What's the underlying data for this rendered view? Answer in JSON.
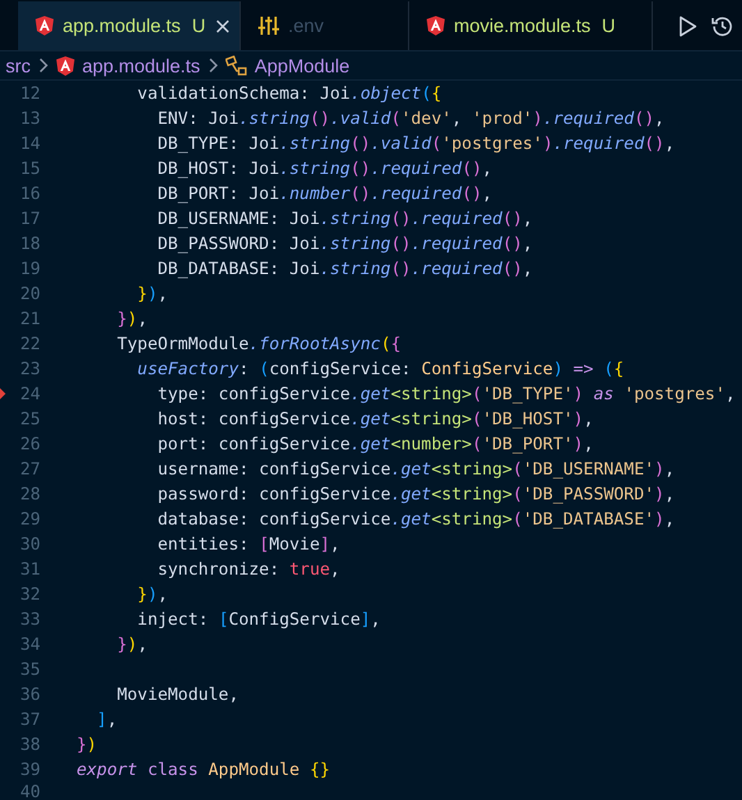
{
  "tabs": [
    {
      "label": "app.module.ts",
      "badge": "U",
      "kind": "file",
      "selected": true,
      "dimmed": false,
      "closable": true
    },
    {
      "label": ".env",
      "kind": "config",
      "selected": false,
      "dimmed": true,
      "closable": false
    },
    {
      "label": "movie.module.ts",
      "badge": "U",
      "kind": "file",
      "selected": false,
      "dimmed": false,
      "closable": false
    }
  ],
  "breadcrumb": [
    {
      "label": "src",
      "kind": "folder"
    },
    {
      "label": "app.module.ts",
      "kind": "file"
    },
    {
      "label": "AppModule",
      "kind": "symbol"
    }
  ],
  "lines": [
    {
      "number": "12",
      "marker": false,
      "tokens": [
        {
          "text": "      validationSchema: Joi",
          "kind": "p"
        },
        {
          "text": ".object",
          "kind": "m"
        },
        {
          "text": "(",
          "kind": "bb"
        },
        {
          "text": "{",
          "kind": "by"
        }
      ]
    },
    {
      "number": "13",
      "marker": false,
      "tokens": [
        {
          "text": "        ENV: Joi",
          "kind": "p"
        },
        {
          "text": ".string",
          "kind": "m"
        },
        {
          "text": "()",
          "kind": "bp"
        },
        {
          "text": ".valid",
          "kind": "m"
        },
        {
          "text": "(",
          "kind": "bp"
        },
        {
          "text": "'dev'",
          "kind": "s"
        },
        {
          "text": ", ",
          "kind": "p"
        },
        {
          "text": "'prod'",
          "kind": "s"
        },
        {
          "text": ")",
          "kind": "bp"
        },
        {
          "text": ".required",
          "kind": "m"
        },
        {
          "text": "()",
          "kind": "bp"
        },
        {
          "text": ",",
          "kind": "p"
        }
      ]
    },
    {
      "number": "14",
      "marker": false,
      "tokens": [
        {
          "text": "        DB_TYPE: Joi",
          "kind": "p"
        },
        {
          "text": ".string",
          "kind": "m"
        },
        {
          "text": "()",
          "kind": "bp"
        },
        {
          "text": ".valid",
          "kind": "m"
        },
        {
          "text": "(",
          "kind": "bp"
        },
        {
          "text": "'postgres'",
          "kind": "s"
        },
        {
          "text": ")",
          "kind": "bp"
        },
        {
          "text": ".required",
          "kind": "m"
        },
        {
          "text": "()",
          "kind": "bp"
        },
        {
          "text": ",",
          "kind": "p"
        }
      ]
    },
    {
      "number": "15",
      "marker": false,
      "tokens": [
        {
          "text": "        DB_HOST: Joi",
          "kind": "p"
        },
        {
          "text": ".string",
          "kind": "m"
        },
        {
          "text": "()",
          "kind": "bp"
        },
        {
          "text": ".required",
          "kind": "m"
        },
        {
          "text": "()",
          "kind": "bp"
        },
        {
          "text": ",",
          "kind": "p"
        }
      ]
    },
    {
      "number": "16",
      "marker": false,
      "tokens": [
        {
          "text": "        DB_PORT: Joi",
          "kind": "p"
        },
        {
          "text": ".number",
          "kind": "m"
        },
        {
          "text": "()",
          "kind": "bp"
        },
        {
          "text": ".required",
          "kind": "m"
        },
        {
          "text": "()",
          "kind": "bp"
        },
        {
          "text": ",",
          "kind": "p"
        }
      ]
    },
    {
      "number": "17",
      "marker": false,
      "tokens": [
        {
          "text": "        DB_USERNAME: Joi",
          "kind": "p"
        },
        {
          "text": ".string",
          "kind": "m"
        },
        {
          "text": "()",
          "kind": "bp"
        },
        {
          "text": ".required",
          "kind": "m"
        },
        {
          "text": "()",
          "kind": "bp"
        },
        {
          "text": ",",
          "kind": "p"
        }
      ]
    },
    {
      "number": "18",
      "marker": false,
      "tokens": [
        {
          "text": "        DB_PASSWORD: Joi",
          "kind": "p"
        },
        {
          "text": ".string",
          "kind": "m"
        },
        {
          "text": "()",
          "kind": "bp"
        },
        {
          "text": ".required",
          "kind": "m"
        },
        {
          "text": "()",
          "kind": "bp"
        },
        {
          "text": ",",
          "kind": "p"
        }
      ]
    },
    {
      "number": "19",
      "marker": false,
      "tokens": [
        {
          "text": "        DB_DATABASE: Joi",
          "kind": "p"
        },
        {
          "text": ".string",
          "kind": "m"
        },
        {
          "text": "()",
          "kind": "bp"
        },
        {
          "text": ".required",
          "kind": "m"
        },
        {
          "text": "()",
          "kind": "bp"
        },
        {
          "text": ",",
          "kind": "p"
        }
      ]
    },
    {
      "number": "20",
      "marker": false,
      "tokens": [
        {
          "text": "      }",
          "kind": "by"
        },
        {
          "text": ")",
          "kind": "bb"
        },
        {
          "text": ",",
          "kind": "p"
        }
      ]
    },
    {
      "number": "21",
      "marker": false,
      "tokens": [
        {
          "text": "    }",
          "kind": "bp"
        },
        {
          "text": ")",
          "kind": "by"
        },
        {
          "text": ",",
          "kind": "p"
        }
      ]
    },
    {
      "number": "22",
      "marker": false,
      "tokens": [
        {
          "text": "    TypeOrmModule",
          "kind": "p"
        },
        {
          "text": ".forRootAsync",
          "kind": "m"
        },
        {
          "text": "(",
          "kind": "by"
        },
        {
          "text": "{",
          "kind": "bp"
        }
      ]
    },
    {
      "number": "23",
      "marker": false,
      "tokens": [
        {
          "text": "      useFactory",
          "kind": "m"
        },
        {
          "text": ": ",
          "kind": "p"
        },
        {
          "text": "(",
          "kind": "bb"
        },
        {
          "text": "configService: ",
          "kind": "p"
        },
        {
          "text": "ConfigService",
          "kind": "c"
        },
        {
          "text": ") ",
          "kind": "bb"
        },
        {
          "text": "=> ",
          "kind": "k"
        },
        {
          "text": "(",
          "kind": "bb"
        },
        {
          "text": "{",
          "kind": "by"
        }
      ]
    },
    {
      "number": "24",
      "marker": true,
      "tokens": [
        {
          "text": "        type: configService",
          "kind": "p"
        },
        {
          "text": ".get",
          "kind": "m"
        },
        {
          "text": "<string>",
          "kind": "g"
        },
        {
          "text": "(",
          "kind": "bp"
        },
        {
          "text": "'DB_TYPE'",
          "kind": "s"
        },
        {
          "text": ") ",
          "kind": "bp"
        },
        {
          "text": "as ",
          "kind": "ki"
        },
        {
          "text": "'postgres'",
          "kind": "s"
        },
        {
          "text": ",",
          "kind": "p"
        }
      ]
    },
    {
      "number": "25",
      "marker": false,
      "tokens": [
        {
          "text": "        host: configService",
          "kind": "p"
        },
        {
          "text": ".get",
          "kind": "m"
        },
        {
          "text": "<string>",
          "kind": "g"
        },
        {
          "text": "(",
          "kind": "bp"
        },
        {
          "text": "'DB_HOST'",
          "kind": "s"
        },
        {
          "text": ")",
          "kind": "bp"
        },
        {
          "text": ",",
          "kind": "p"
        }
      ]
    },
    {
      "number": "26",
      "marker": false,
      "tokens": [
        {
          "text": "        port: configService",
          "kind": "p"
        },
        {
          "text": ".get",
          "kind": "m"
        },
        {
          "text": "<number>",
          "kind": "g"
        },
        {
          "text": "(",
          "kind": "bp"
        },
        {
          "text": "'DB_PORT'",
          "kind": "s"
        },
        {
          "text": ")",
          "kind": "bp"
        },
        {
          "text": ",",
          "kind": "p"
        }
      ]
    },
    {
      "number": "27",
      "marker": false,
      "tokens": [
        {
          "text": "        username: configService",
          "kind": "p"
        },
        {
          "text": ".get",
          "kind": "m"
        },
        {
          "text": "<string>",
          "kind": "g"
        },
        {
          "text": "(",
          "kind": "bp"
        },
        {
          "text": "'DB_USERNAME'",
          "kind": "s"
        },
        {
          "text": ")",
          "kind": "bp"
        },
        {
          "text": ",",
          "kind": "p"
        }
      ]
    },
    {
      "number": "28",
      "marker": false,
      "tokens": [
        {
          "text": "        password: configService",
          "kind": "p"
        },
        {
          "text": ".get",
          "kind": "m"
        },
        {
          "text": "<string>",
          "kind": "g"
        },
        {
          "text": "(",
          "kind": "bp"
        },
        {
          "text": "'DB_PASSWORD'",
          "kind": "s"
        },
        {
          "text": ")",
          "kind": "bp"
        },
        {
          "text": ",",
          "kind": "p"
        }
      ]
    },
    {
      "number": "29",
      "marker": false,
      "tokens": [
        {
          "text": "        database: configService",
          "kind": "p"
        },
        {
          "text": ".get",
          "kind": "m"
        },
        {
          "text": "<string>",
          "kind": "g"
        },
        {
          "text": "(",
          "kind": "bp"
        },
        {
          "text": "'DB_DATABASE'",
          "kind": "s"
        },
        {
          "text": ")",
          "kind": "bp"
        },
        {
          "text": ",",
          "kind": "p"
        }
      ]
    },
    {
      "number": "30",
      "marker": false,
      "tokens": [
        {
          "text": "        entities: ",
          "kind": "p"
        },
        {
          "text": "[",
          "kind": "bp"
        },
        {
          "text": "Movie",
          "kind": "p"
        },
        {
          "text": "]",
          "kind": "bp"
        },
        {
          "text": ",",
          "kind": "p"
        }
      ]
    },
    {
      "number": "31",
      "marker": false,
      "tokens": [
        {
          "text": "        synchronize: ",
          "kind": "p"
        },
        {
          "text": "true",
          "kind": "lit"
        },
        {
          "text": ",",
          "kind": "p"
        }
      ]
    },
    {
      "number": "32",
      "marker": false,
      "tokens": [
        {
          "text": "      }",
          "kind": "by"
        },
        {
          "text": ")",
          "kind": "bb"
        },
        {
          "text": ",",
          "kind": "p"
        }
      ]
    },
    {
      "number": "33",
      "marker": false,
      "tokens": [
        {
          "text": "      inject: ",
          "kind": "p"
        },
        {
          "text": "[",
          "kind": "bb"
        },
        {
          "text": "ConfigService",
          "kind": "p"
        },
        {
          "text": "]",
          "kind": "bb"
        },
        {
          "text": ",",
          "kind": "p"
        }
      ]
    },
    {
      "number": "34",
      "marker": false,
      "tokens": [
        {
          "text": "    }",
          "kind": "bp"
        },
        {
          "text": ")",
          "kind": "by"
        },
        {
          "text": ",",
          "kind": "p"
        }
      ]
    },
    {
      "number": "35",
      "marker": false
    },
    {
      "number": "36",
      "marker": false,
      "tokens": [
        {
          "text": "    MovieModule,",
          "kind": "p"
        }
      ]
    },
    {
      "number": "37",
      "marker": false,
      "tokens": [
        {
          "text": "  ]",
          "kind": "bb"
        },
        {
          "text": ",",
          "kind": "p"
        }
      ]
    },
    {
      "number": "38",
      "marker": false,
      "tokens": [
        {
          "text": "}",
          "kind": "bp"
        },
        {
          "text": ")",
          "kind": "by"
        }
      ]
    },
    {
      "number": "39",
      "marker": false,
      "tokens": [
        {
          "text": "export ",
          "kind": "ki"
        },
        {
          "text": "class ",
          "kind": "k"
        },
        {
          "text": "AppModule ",
          "kind": "c"
        },
        {
          "text": "{}",
          "kind": "by"
        }
      ]
    },
    {
      "number": "40",
      "marker": false
    }
  ]
}
